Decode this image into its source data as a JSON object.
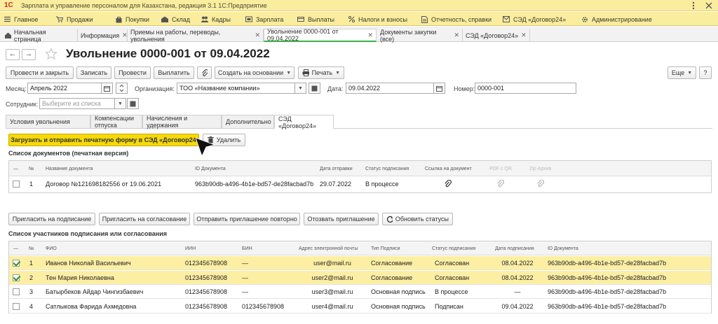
{
  "app": {
    "title": "Зарплата и управление персоналом для Казахстана, редакция 3.1 1С:Предприятие",
    "logo": "1С"
  },
  "menu": [
    {
      "icon": "hamburger-icon",
      "label": "Главное"
    },
    {
      "icon": "cart-icon",
      "label": "Продажи"
    },
    {
      "icon": "bag-icon",
      "label": "Покупки"
    },
    {
      "icon": "warehouse-icon",
      "label": "Склад"
    },
    {
      "icon": "people-icon",
      "label": "Кадры"
    },
    {
      "icon": "salary-icon",
      "label": "Зарплата"
    },
    {
      "icon": "payments-icon",
      "label": "Выплаты"
    },
    {
      "icon": "percent-icon",
      "label": "Налоги и взносы"
    },
    {
      "icon": "report-icon",
      "label": "Отчетность, справки"
    },
    {
      "icon": "sed-icon",
      "label": "СЭД «Договор24»"
    },
    {
      "icon": "gear-icon",
      "label": "Администрирование"
    }
  ],
  "tabs": [
    {
      "label": "Начальная страница"
    },
    {
      "label": "Информация"
    },
    {
      "label": "Приемы на работы, переводы, увольнения"
    },
    {
      "label": "Увольнение 0000-001 от 09.04.2022"
    },
    {
      "label": "Документы закупки (все)"
    },
    {
      "label": "СЭД «Договор24»"
    }
  ],
  "document": {
    "title": "Увольнение 0000-001 от 09.04.2022"
  },
  "toolbar": {
    "post_close": "Провести и закрыть",
    "save": "Записать",
    "post": "Провести",
    "pay": "Выплатить",
    "create_based": "Создать на основании",
    "print": "Печать",
    "more": "Еще",
    "help": "?"
  },
  "form": {
    "month_label": "Месяц:",
    "month_value": "Апрель 2022",
    "org_label": "Организация:",
    "org_value": "ТОО «Название компании»",
    "date_label": "Дата:",
    "date_value": "09.04.2022",
    "number_label": "Номер:",
    "number_value": "0000-001",
    "employee_label": "Сотрудник:",
    "employee_placeholder": "Выберите из списка"
  },
  "form_tabs": [
    "Условия увольнения",
    "Компенсации отпуска",
    "Начисления и удержания",
    "Дополнительно",
    "СЭД «Договор24»"
  ],
  "sed": {
    "upload_button": "Загрузить и отправить печатную форму в СЭД «Договор24»",
    "delete_button": "Удалить",
    "docs_title": "Список документов (печатная версия)",
    "docs_headers": {
      "dash": "—",
      "num": "№",
      "name": "Название документа",
      "id": "ID Документа",
      "date": "Дата отправки",
      "status": "Статус подписания",
      "link": "Ссылка на документ",
      "pdf": "PDF с QR",
      "zip": "Zip Архив"
    },
    "docs_rows": [
      {
        "num": "1",
        "name": "Договор №121698182556 от 19.06.2021",
        "id": "963b90db-a496-4b1e-bd57-de28facbad7b",
        "date": "29.07.2022",
        "status": "В процессе"
      }
    ],
    "actions": {
      "invite_sign": "Пригласить на подписание",
      "invite_approve": "Пригласить на согласование",
      "resend": "Отправить приглашение повторно",
      "revoke": "Отозвать приглашение",
      "refresh": "Обновить статусы"
    },
    "participants_title": "Список участников подписания или согласования",
    "part_headers": {
      "dash": "—",
      "num": "№",
      "fio": "ФИО",
      "iin": "ИИН",
      "bin": "БИН",
      "email": "Адрес электронной почты",
      "type": "Тип Подписи",
      "status": "Статус подписания",
      "date": "Дата подписания",
      "id": "ID Документа"
    },
    "participants": [
      {
        "checked": true,
        "highlight": true,
        "num": "1",
        "fio": "Иванов Николай Васильевич",
        "iin": "012345678908",
        "bin": "—",
        "email": "user@mail.ru",
        "type": "Согласование",
        "status": "Согласован",
        "date": "08.04.2022",
        "id": "963b90db-a496-4b1e-bd57-de28facbad7b"
      },
      {
        "checked": true,
        "highlight": true,
        "num": "2",
        "fio": "Тен Мария Николаевна",
        "iin": "012345678908",
        "bin": "—",
        "email": "user2@mail.ru",
        "type": "Согласование",
        "status": "Согласован",
        "date": "08.04.2022",
        "id": "963b90db-a496-4b1e-bd57-de28facbad7b"
      },
      {
        "checked": false,
        "highlight": false,
        "num": "3",
        "fio": "Батырбеков Айдар Чингизбаевич",
        "iin": "012345678908",
        "bin": "—",
        "email": "user3@mail.ru",
        "type": "Основная подпись",
        "status": "В процессе",
        "date": "—",
        "id": "963b90db-a496-4b1e-bd57-de28facbad7b"
      },
      {
        "checked": false,
        "highlight": false,
        "num": "4",
        "fio": "Сатлыкова Фарида Ахмедовна",
        "iin": "012345678908",
        "bin": "012345678908",
        "email": "user4@mail.ru",
        "type": "Основная подпись",
        "status": "Подписан",
        "date": "09.04.2022",
        "id": "963b90db-a496-4b1e-bd57-de28facbad7b"
      }
    ]
  },
  "colors": {
    "menu_bg": "#fbed9e",
    "accent_yellow": "#f5d90a",
    "row_highlight": "#fcefa4",
    "active_tab_line": "#3cb044"
  }
}
